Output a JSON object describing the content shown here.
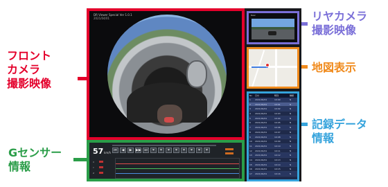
{
  "callouts": {
    "front": [
      "フロント",
      "カメラ",
      "撮影映像"
    ],
    "gsensor": [
      "Gセンサー",
      "情報"
    ],
    "rear": [
      "リヤカメラ",
      "撮影映像"
    ],
    "map": [
      "地図表示"
    ],
    "log": [
      "記録データ",
      "情報"
    ]
  },
  "colors": {
    "front": "#e4002b",
    "gsensor": "#2a9d48",
    "rear": "#7a6fd8",
    "map": "#f08a1c",
    "log": "#35a3dc"
  },
  "player": {
    "title": "DR Viewer Special Ver 1.0.1",
    "subtitle": "2021/04/01",
    "speed": "57",
    "speed_unit": "km/h",
    "controls": [
      "⏮",
      "◀",
      "▶",
      "▶▶",
      "⏭",
      "⏷",
      "⏷",
      "⏷",
      "⏷",
      "⏷",
      "⏷",
      "⏷",
      "⏷"
    ]
  },
  "gsensor": {
    "axes": [
      "X",
      "Y",
      "Z"
    ]
  },
  "rear": {
    "title": "Rear"
  },
  "log": {
    "headers": [
      "No",
      "日付",
      "時刻",
      "種類"
    ],
    "rows": [
      [
        "1",
        "2021/04/01",
        "10:00",
        "N"
      ],
      [
        "2",
        "2021/04/01",
        "10:01",
        "N"
      ],
      [
        "3",
        "2021/04/01",
        "10:02",
        "N"
      ],
      [
        "4",
        "2021/04/01",
        "10:03",
        "N"
      ],
      [
        "5",
        "2021/04/01",
        "10:04",
        "N"
      ],
      [
        "6",
        "2021/04/01",
        "10:05",
        "N"
      ],
      [
        "7",
        "2021/04/01",
        "10:06",
        "N"
      ],
      [
        "8",
        "2021/04/01",
        "10:07",
        "N"
      ],
      [
        "9",
        "2021/04/01",
        "10:08",
        "N"
      ],
      [
        "10",
        "2021/04/01",
        "10:09",
        "N"
      ],
      [
        "11",
        "2021/04/01",
        "10:10",
        "N"
      ],
      [
        "12",
        "2021/04/01",
        "10:11",
        "N"
      ],
      [
        "13",
        "2021/04/01",
        "10:12",
        "N"
      ],
      [
        "14",
        "2021/04/01",
        "10:13",
        "N"
      ],
      [
        "15",
        "2021/04/01",
        "10:14",
        "N"
      ],
      [
        "16",
        "2021/04/01",
        "10:15",
        "N"
      ],
      [
        "17",
        "2021/04/01",
        "10:16",
        "N"
      ]
    ]
  }
}
